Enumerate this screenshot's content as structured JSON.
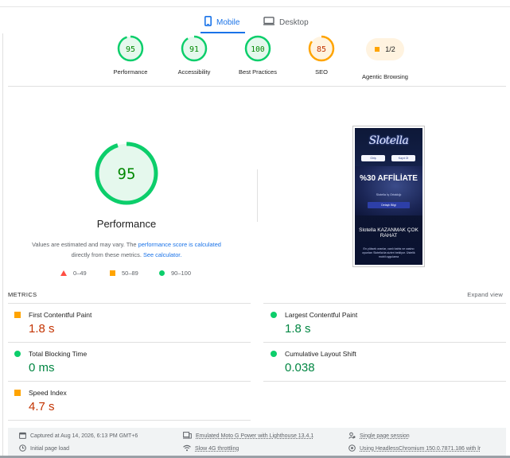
{
  "tabs": [
    {
      "label": "Mobile",
      "icon": "mobile-icon",
      "active": true
    },
    {
      "label": "Desktop",
      "icon": "desktop-icon",
      "active": false
    }
  ],
  "categories": [
    {
      "score": "95",
      "label": "Performance",
      "color": "#0cce6b"
    },
    {
      "score": "91",
      "label": "Accessibility",
      "color": "#0cce6b"
    },
    {
      "score": "100",
      "label": "Best Practices",
      "color": "#0cce6b"
    },
    {
      "score": "85",
      "label": "SEO",
      "color": "#ffa400"
    },
    {
      "score": "1/2",
      "label": "Agentic Browsing",
      "color": "#ffa400"
    }
  ],
  "performance": {
    "score": "95",
    "title": "Performance",
    "note_prefix": "Values are estimated and may vary. The ",
    "note_link1": "performance score is calculated",
    "note_middle": " directly from these metrics. ",
    "note_link2": "See calculator."
  },
  "legend": [
    {
      "label": "0–49",
      "color": "#ff4e42"
    },
    {
      "label": "50–89",
      "color": "#ffa400"
    },
    {
      "label": "90–100",
      "color": "#0cce6b"
    }
  ],
  "thumbnail": {
    "logo": "Slotella",
    "btn1": "Giriş",
    "btn2": "Kayıt Ol",
    "headline": "%30 AFFİLİATE",
    "sub": "Slotella İş Ortaklığı",
    "cta": "Detaylı Bilgi",
    "headline2": "Slotella KAZANMAK ÇOK RAHAT",
    "para": "En yüksek oranlar, canlı bahis ve casino oyunları Slotella'da sizleri bekliyor. Üstelik mobil uygulama"
  },
  "metrics": {
    "title": "METRICS",
    "expand": "Expand view",
    "items": [
      {
        "name": "First Contentful Paint",
        "value": "1.8 s",
        "status": "average"
      },
      {
        "name": "Largest Contentful Paint",
        "value": "1.8 s",
        "status": "pass"
      },
      {
        "name": "Total Blocking Time",
        "value": "0 ms",
        "status": "pass"
      },
      {
        "name": "Cumulative Layout Shift",
        "value": "0.038",
        "status": "pass"
      },
      {
        "name": "Speed Index",
        "value": "4.7 s",
        "status": "average"
      }
    ]
  },
  "footer": {
    "captured": "Captured at Aug 14, 2026, 6:13 PM GMT+6",
    "device": "Emulated Moto G Power with Lighthouse 13.4.1",
    "session": "Single page session",
    "load": "Initial page load",
    "throttle": "Slow 4G throttling",
    "browser": "Using HeadlessChromium 150.0.7871.186 with lr"
  },
  "colors": {
    "pass": "#0cce6b",
    "average": "#ffa400",
    "fail": "#ff4e42",
    "link": "#1a73e8"
  }
}
